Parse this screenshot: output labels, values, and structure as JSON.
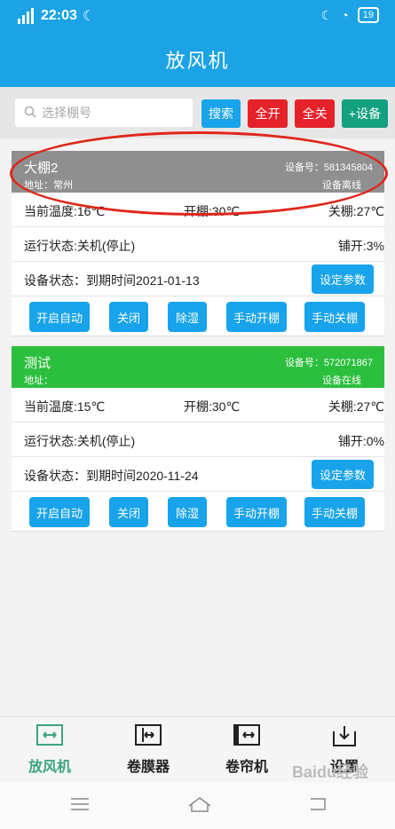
{
  "status": {
    "network": "4G HD",
    "time": "22:03",
    "battery": "19"
  },
  "header": {
    "title": "放风机"
  },
  "search": {
    "placeholder": "选择棚号",
    "search_label": "搜索",
    "all_on_label": "全开",
    "all_off_label": "全关",
    "add_label": "+设备",
    "colors": {
      "search": "#18a3ea",
      "all_on": "#e5222a",
      "all_off": "#e5222a",
      "add": "#13a07e"
    }
  },
  "devices": [
    {
      "name": "大棚2",
      "address": "地址：常州",
      "device_no": "设备号：581345804",
      "device_status": "设备离线",
      "head_color": "#8f8f8f",
      "temp": "当前温度:16℃",
      "open_shed": "开棚:30℃",
      "close_shed": "关棚:27℃",
      "run_state": "运行状态:关机(停止)",
      "spread": "铺开:3%",
      "expiry": "设备状态：到期时间2021-01-13",
      "set_params": "设定参数",
      "actions": [
        "开启自动",
        "关闭",
        "除湿",
        "手动开棚",
        "手动关棚"
      ]
    },
    {
      "name": "测试",
      "address": "地址：",
      "device_no": "设备号：572071867",
      "device_status": "设备在线",
      "head_color": "#2cbf3e",
      "temp": "当前温度:15℃",
      "open_shed": "开棚:30℃",
      "close_shed": "关棚:27℃",
      "run_state": "运行状态:关机(停止)",
      "spread": "铺开:0%",
      "expiry": "设备状态：到期时间2020-11-24",
      "set_params": "设定参数",
      "actions": [
        "开启自动",
        "关闭",
        "除湿",
        "手动开棚",
        "手动关棚"
      ]
    }
  ],
  "tabs": [
    {
      "label": "放风机",
      "icon": "vent-icon",
      "active": true
    },
    {
      "label": "卷膜器",
      "icon": "film-roller-icon",
      "active": false
    },
    {
      "label": "卷帘机",
      "icon": "curtain-icon",
      "active": false
    },
    {
      "label": "设置",
      "icon": "download-icon",
      "active": false
    }
  ],
  "watermark": "Baidu经验"
}
